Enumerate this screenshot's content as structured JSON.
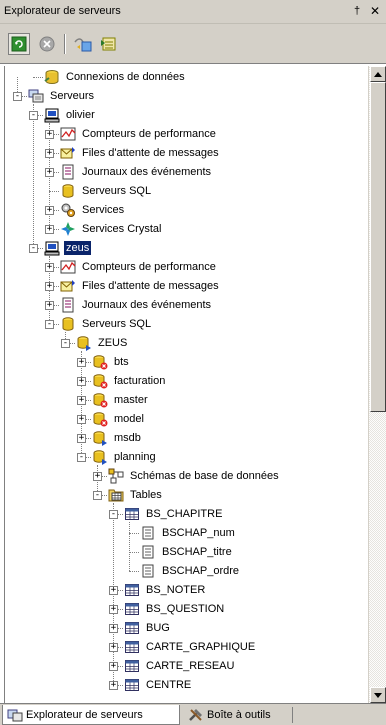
{
  "window": {
    "title": "Explorateur de serveurs",
    "pin_glyph": "†",
    "close_glyph": "✕"
  },
  "toolbar": {
    "buttons": [
      {
        "name": "refresh-button",
        "icon": "refresh-icon",
        "pressed": true
      },
      {
        "name": "stop-button",
        "icon": "stop-icon",
        "pressed": false
      },
      {
        "name": "connect-server-button",
        "icon": "connect-server-icon",
        "pressed": false
      },
      {
        "name": "connect-database-button",
        "icon": "connect-database-icon",
        "pressed": false
      }
    ]
  },
  "tree": {
    "items": [
      {
        "label": "Connexions de données",
        "icon": "data-connections-icon",
        "level": 1,
        "toggle": null
      },
      {
        "label": "Serveurs",
        "icon": "servers-icon",
        "level": 0,
        "toggle": "-"
      },
      {
        "label": "olivier",
        "icon": "computer-icon",
        "level": 1,
        "toggle": "-"
      },
      {
        "label": "Compteurs de performance",
        "icon": "performance-counters-icon",
        "level": 2,
        "toggle": "+"
      },
      {
        "label": "Files d'attente de messages",
        "icon": "message-queues-icon",
        "level": 2,
        "toggle": "+"
      },
      {
        "label": "Journaux des événements",
        "icon": "event-logs-icon",
        "level": 2,
        "toggle": "+"
      },
      {
        "label": "Serveurs SQL",
        "icon": "sql-servers-icon",
        "level": 2,
        "toggle": null
      },
      {
        "label": "Services",
        "icon": "services-icon",
        "level": 2,
        "toggle": "+"
      },
      {
        "label": "Services Crystal",
        "icon": "crystal-services-icon",
        "level": 2,
        "toggle": "+"
      },
      {
        "label": "zeus",
        "icon": "computer-icon",
        "level": 1,
        "toggle": "-",
        "selected": true
      },
      {
        "label": "Compteurs de performance",
        "icon": "performance-counters-icon",
        "level": 2,
        "toggle": "+"
      },
      {
        "label": "Files d'attente de messages",
        "icon": "message-queues-icon",
        "level": 2,
        "toggle": "+"
      },
      {
        "label": "Journaux des événements",
        "icon": "event-logs-icon",
        "level": 2,
        "toggle": "+"
      },
      {
        "label": "Serveurs SQL",
        "icon": "sql-servers-icon",
        "level": 2,
        "toggle": "-"
      },
      {
        "label": "ZEUS",
        "icon": "sql-instance-icon",
        "level": 3,
        "toggle": "-"
      },
      {
        "label": "bts",
        "icon": "database-error-icon",
        "level": 4,
        "toggle": "+"
      },
      {
        "label": "facturation",
        "icon": "database-error-icon",
        "level": 4,
        "toggle": "+"
      },
      {
        "label": "master",
        "icon": "database-error-icon",
        "level": 4,
        "toggle": "+"
      },
      {
        "label": "model",
        "icon": "database-error-icon",
        "level": 4,
        "toggle": "+"
      },
      {
        "label": "msdb",
        "icon": "database-icon",
        "level": 4,
        "toggle": "+"
      },
      {
        "label": "planning",
        "icon": "database-icon",
        "level": 4,
        "toggle": "-"
      },
      {
        "label": "Schémas de base de données",
        "icon": "diagram-icon",
        "level": 5,
        "toggle": "+"
      },
      {
        "label": "Tables",
        "icon": "tables-folder-icon",
        "level": 5,
        "toggle": "-"
      },
      {
        "label": "BS_CHAPITRE",
        "icon": "table-icon",
        "level": 6,
        "toggle": "-"
      },
      {
        "label": "BSCHAP_num",
        "icon": "column-icon",
        "level": 7,
        "toggle": null
      },
      {
        "label": "BSCHAP_titre",
        "icon": "column-icon",
        "level": 7,
        "toggle": null
      },
      {
        "label": "BSCHAP_ordre",
        "icon": "column-icon",
        "level": 7,
        "toggle": null
      },
      {
        "label": "BS_NOTER",
        "icon": "table-icon",
        "level": 6,
        "toggle": "+"
      },
      {
        "label": "BS_QUESTION",
        "icon": "table-icon",
        "level": 6,
        "toggle": "+"
      },
      {
        "label": "BUG",
        "icon": "table-icon",
        "level": 6,
        "toggle": "+"
      },
      {
        "label": "CARTE_GRAPHIQUE",
        "icon": "table-icon",
        "level": 6,
        "toggle": "+"
      },
      {
        "label": "CARTE_RESEAU",
        "icon": "table-icon",
        "level": 6,
        "toggle": "+"
      },
      {
        "label": "CENTRE",
        "icon": "table-icon",
        "level": 6,
        "toggle": "+"
      }
    ]
  },
  "tabs": [
    {
      "label": "Explorateur de serveurs",
      "icon": "server-explorer-icon",
      "active": true
    },
    {
      "label": "Boîte à outils",
      "icon": "toolbox-icon",
      "active": false
    }
  ]
}
